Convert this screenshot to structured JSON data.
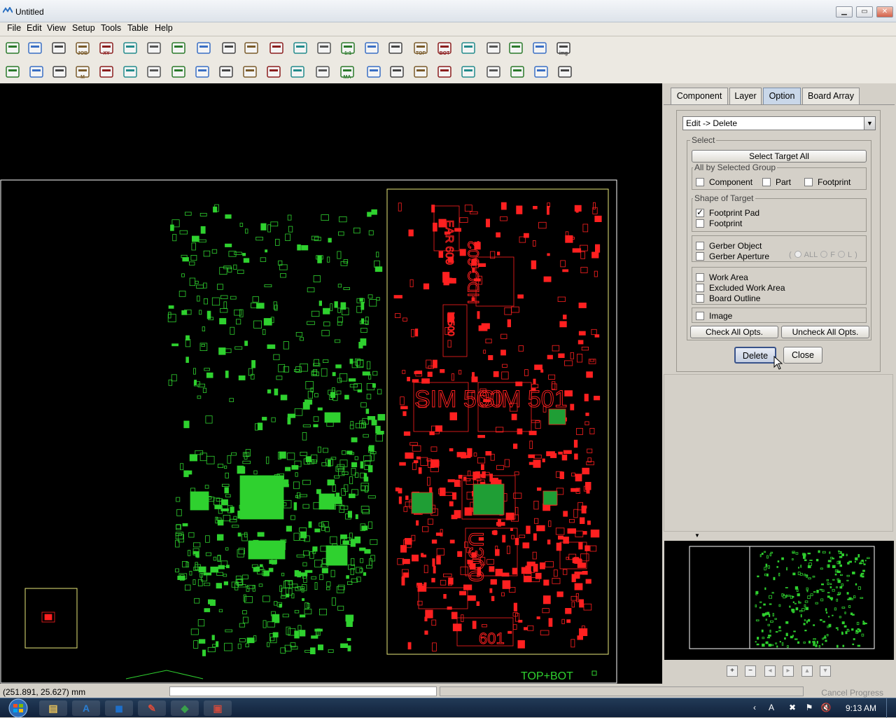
{
  "window": {
    "title": "Untitled"
  },
  "menu": [
    "File",
    "Edit",
    "View",
    "Setup",
    "Tools",
    "Table",
    "Help"
  ],
  "toolbar1": [
    {
      "name": "new-file-icon"
    },
    {
      "name": "open-folder-icon"
    },
    {
      "name": "save-icon"
    },
    {
      "name": "load-job-icon",
      "label": "JOB"
    },
    {
      "name": "load-xy-icon",
      "label": "XY"
    },
    {
      "name": "gerber-import-icon"
    },
    {
      "name": "export-icon"
    },
    {
      "name": "board-icon"
    },
    {
      "name": "checklist-icon"
    },
    {
      "name": "undo-icon"
    },
    {
      "name": "redo-icon"
    },
    {
      "name": "zoom-in-icon"
    },
    {
      "name": "zoom-out-icon"
    },
    {
      "name": "zoom-fit-icon"
    },
    {
      "name": "zoom-actual-icon",
      "label": "1:1"
    },
    {
      "name": "measure-icon"
    },
    {
      "name": "ruler-icon"
    },
    {
      "name": "view-top-icon",
      "label": "TOP"
    },
    {
      "name": "view-bot-icon",
      "label": "BOT"
    },
    {
      "name": "graph-icon"
    },
    {
      "name": "layers-icon"
    },
    {
      "name": "eraser-icon"
    },
    {
      "name": "grid-icon"
    },
    {
      "name": "image-icon",
      "label": "img"
    }
  ],
  "toolbar2": [
    {
      "name": "select-area-icon"
    },
    {
      "name": "select-pick-icon"
    },
    {
      "name": "rect-icon"
    },
    {
      "name": "marker-icon",
      "label": "M"
    },
    {
      "name": "component-icon"
    },
    {
      "name": "array-icon"
    },
    {
      "name": "multi-component-icon"
    },
    {
      "name": "mark-gray-icon"
    },
    {
      "name": "chip-icon"
    },
    {
      "name": "chip-gray-icon"
    },
    {
      "name": "pattern-icon"
    },
    {
      "name": "transfer-icon"
    },
    {
      "name": "origin-icon"
    },
    {
      "name": "globe-icon"
    },
    {
      "name": "ma-icon",
      "label": "MA"
    },
    {
      "name": "delete-layer-icon"
    },
    {
      "name": "scale-icon"
    },
    {
      "name": "rotate-icon"
    },
    {
      "name": "mirror-icon"
    },
    {
      "name": "stack-icon"
    },
    {
      "name": "align-left-icon"
    },
    {
      "name": "align-right-icon"
    },
    {
      "name": "skew-icon"
    },
    {
      "name": "flip-icon"
    }
  ],
  "tabs": [
    "Component",
    "Layer",
    "Option",
    "Board Array"
  ],
  "active_tab": "Option",
  "option": {
    "mode_value": "Edit -> Delete",
    "select_legend": "Select",
    "select_target_all": "Select Target All",
    "group_legend": "All by Selected Group",
    "group_items": [
      {
        "label": "Component",
        "checked": false
      },
      {
        "label": "Part",
        "checked": false
      },
      {
        "label": "Footprint",
        "checked": false
      }
    ],
    "shape_legend": "Shape of Target",
    "shape_items": [
      {
        "label": "Footprint Pad",
        "checked": true
      },
      {
        "label": "Footprint",
        "checked": false
      }
    ],
    "gerber_items": [
      {
        "label": "Gerber Object",
        "checked": false
      },
      {
        "label": "Gerber Aperture",
        "checked": false
      }
    ],
    "aperture_opts": [
      "ALL",
      "F",
      "L"
    ],
    "area_items": [
      {
        "label": "Work Area",
        "checked": false
      },
      {
        "label": "Excluded Work Area",
        "checked": false
      },
      {
        "label": "Board Outline",
        "checked": false
      }
    ],
    "image_item": {
      "label": "Image",
      "checked": false
    },
    "check_all": "Check All Opts.",
    "uncheck_all": "Uncheck All Opts.",
    "delete": "Delete",
    "close": "Close"
  },
  "canvas": {
    "labels": [
      "EAR 600",
      "HDC 602",
      "LED",
      "IC500",
      "SIM 500",
      "SIM 501",
      "U300",
      "601"
    ],
    "view_label": "TOP+BOT"
  },
  "colors": {
    "top_layer": "#ff2020",
    "bot_layer": "#2fd12f",
    "outline": "#e8e87a"
  },
  "status": {
    "coords": "(251.891, 25.627) mm",
    "cancel": "Cancel Progress"
  },
  "taskbar": {
    "apps": [
      "explorer-icon",
      "font-app-icon",
      "dashboard-icon",
      "paint-icon",
      "pcb-viewer-icon",
      "media-icon"
    ],
    "clock": "9:13 AM"
  }
}
